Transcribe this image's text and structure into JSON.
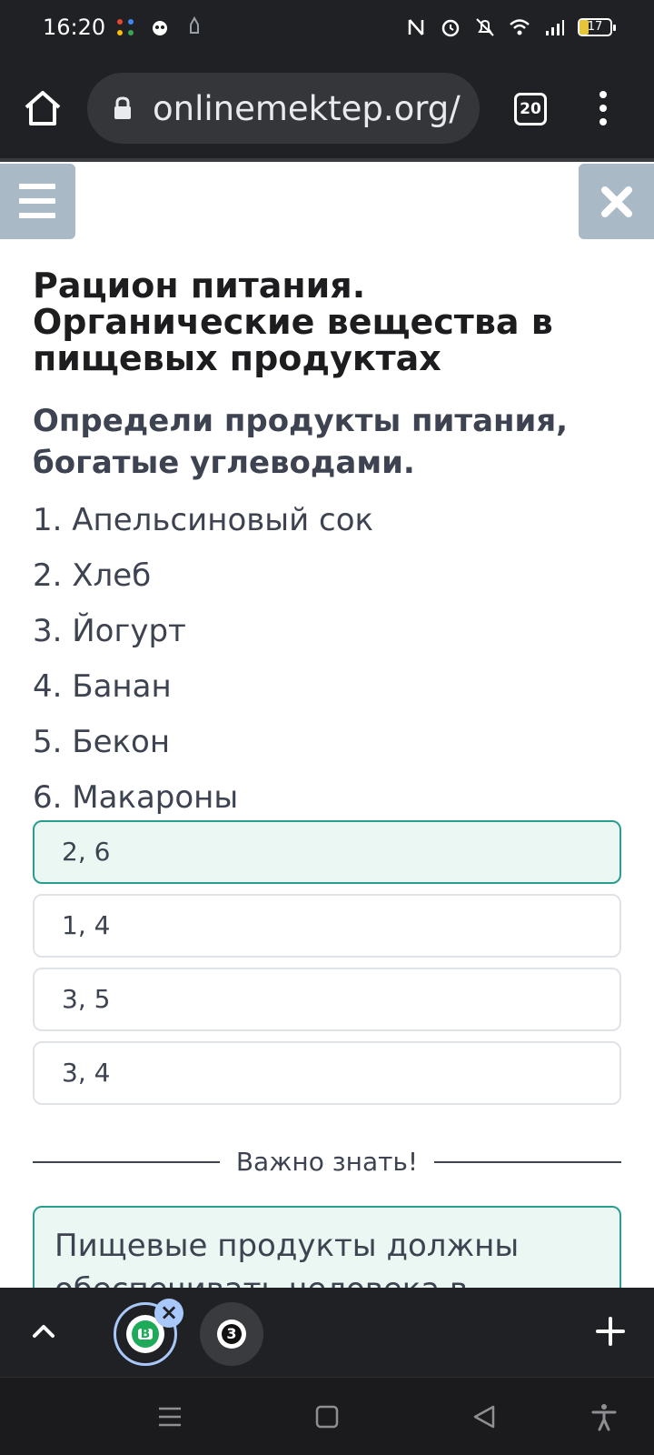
{
  "status_bar": {
    "time": "16:20",
    "battery": "17"
  },
  "browser": {
    "url": "onlinemektep.org/",
    "tab_count": "20"
  },
  "page": {
    "title": "Рацион питания. Органические вещества в пищевых продуктах",
    "question": "Определи продукты питания, богатые углеводами.",
    "items": [
      "1. Апельсиновый сок",
      "2. Хлеб",
      "3. Йогурт",
      "4. Банан",
      "5. Бекон",
      "6. Макароны"
    ],
    "options": [
      {
        "label": "2, 6",
        "selected": true
      },
      {
        "label": "1, 4",
        "selected": false
      },
      {
        "label": "3, 5",
        "selected": false
      },
      {
        "label": "3, 4",
        "selected": false
      }
    ],
    "divider_label": "Важно знать!",
    "info_text": "Пищевые продукты должны обеспечивать человека в"
  },
  "tab_strip": {
    "active_tab_glyph": "B",
    "inactive_tab_glyph": "3"
  },
  "colors": {
    "accent": "#2a9d8f",
    "selected_bg": "#eaf7f3",
    "header_button": "#a9b9c6",
    "browser_chrome": "#202124"
  },
  "icons": [
    "home-icon",
    "lock-icon",
    "tab-switcher-icon",
    "more-vert-icon",
    "hamburger-icon",
    "close-icon",
    "chevron-up-icon",
    "plus-icon",
    "nav-menu-icon",
    "nav-home-icon",
    "nav-back-icon",
    "accessibility-icon"
  ]
}
